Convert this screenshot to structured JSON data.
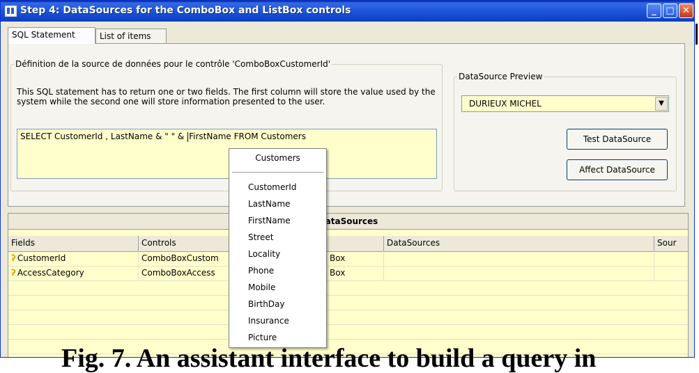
{
  "window": {
    "title": "Step 4: DataSources for the ComboBox and ListBox controls"
  },
  "tabs": [
    {
      "label": "SQL Statement"
    },
    {
      "label": "List of items"
    }
  ],
  "definition": {
    "legend": "Définition de la source de données pour le contrôle 'ComboBoxCustomerId'",
    "description": "This SQL statement has to return one or two fields. The first column will store the value used by the system while the second one will store information presented to the user.",
    "sql_before_caret": "SELECT CustomerId , LastName & \" \" & ",
    "sql_after_caret": "FirstName FROM Customers"
  },
  "preview": {
    "legend": "DataSource Preview",
    "selected_value": "DURIEUX MICHEL",
    "test_button": "Test DataSource",
    "affect_button": "Affect DataSource"
  },
  "grid": {
    "caption": "DataSources",
    "headers": [
      "Fields",
      "Controls",
      "",
      "DataSources",
      "Sour"
    ],
    "rows": [
      {
        "field": "CustomerId",
        "control": "ComboBoxCustom",
        "type": "Box",
        "datasource": ""
      },
      {
        "field": "AccessCategory",
        "control": "ComboBoxAccess",
        "type": "Box",
        "datasource": ""
      }
    ]
  },
  "popup": {
    "header": "Customers",
    "items": [
      "CustomerId",
      "LastName",
      "FirstName",
      "Street",
      "Locality",
      "Phone",
      "Mobile",
      "BirthDay",
      "Insurance",
      "Picture"
    ]
  },
  "caption": "Fig. 7. An assistant interface to build a query in",
  "icons": {
    "app": "table-icon",
    "key": "key-icon",
    "dropdown": "chevron-down-icon"
  }
}
